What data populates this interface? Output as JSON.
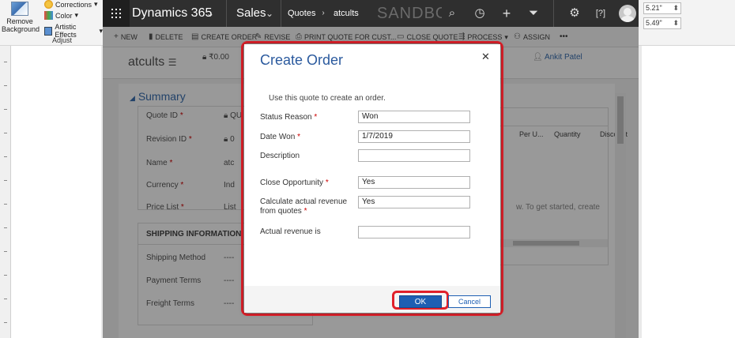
{
  "word": {
    "remove_background": "Remove Background",
    "corrections": "Corrections",
    "color": "Color",
    "artistic_effects": "Artistic Effects",
    "adjust_group": "Adjust",
    "spin1": "5.21\"",
    "spin2": "5.49\""
  },
  "nav": {
    "app_name": "Dynamics 365",
    "area": "Sales",
    "breadcrumb_1": "Quotes",
    "breadcrumb_2": "atcults",
    "env_label": "SANDBOX"
  },
  "commands": {
    "new": "NEW",
    "delete": "DELETE",
    "create_order": "CREATE ORDER",
    "revise": "REVISE",
    "print_quote": "PRINT QUOTE FOR CUST...",
    "close_quote": "CLOSE QUOTE",
    "process": "PROCESS",
    "assign": "ASSIGN",
    "more": "•••"
  },
  "record": {
    "name": "atcults",
    "amount": "₹0.00",
    "owner": "Ankit Patel"
  },
  "summary": {
    "title": "Summary",
    "fields": [
      {
        "label": "Quote ID",
        "value": "QU"
      },
      {
        "label": "Revision ID",
        "value": "0"
      },
      {
        "label": "Name",
        "value": "atc"
      },
      {
        "label": "Currency",
        "value": "Ind"
      },
      {
        "label": "Price List",
        "value": "List"
      }
    ],
    "shipping_title": "SHIPPING INFORMATION",
    "shipping_fields": [
      {
        "label": "Shipping Method",
        "value": "----"
      },
      {
        "label": "Payment Terms",
        "value": "----"
      },
      {
        "label": "Freight Terms",
        "value": "----"
      }
    ]
  },
  "products_grid": {
    "columns": [
      "Per U...",
      "Quantity",
      "Discount"
    ],
    "empty_message": "w. To get started, create"
  },
  "dialog": {
    "title": "Create Order",
    "message": "Use this quote to create an order.",
    "fields": [
      {
        "label": "Status Reason",
        "required": true,
        "value": "Won"
      },
      {
        "label": "Date Won",
        "required": true,
        "value": "1/7/2019"
      },
      {
        "label": "Description",
        "required": false,
        "value": ""
      },
      {
        "label": "Close Opportunity",
        "required": true,
        "value": "Yes"
      },
      {
        "label": "Calculate actual revenue from quotes",
        "required": true,
        "value": "Yes"
      },
      {
        "label": "Actual revenue is",
        "required": false,
        "value": ""
      }
    ],
    "ok": "OK",
    "cancel": "Cancel"
  },
  "colors": {
    "brand_blue": "#2b5a9e",
    "highlight_red": "#e0202a",
    "nav_dark": "#2f2f2f"
  }
}
